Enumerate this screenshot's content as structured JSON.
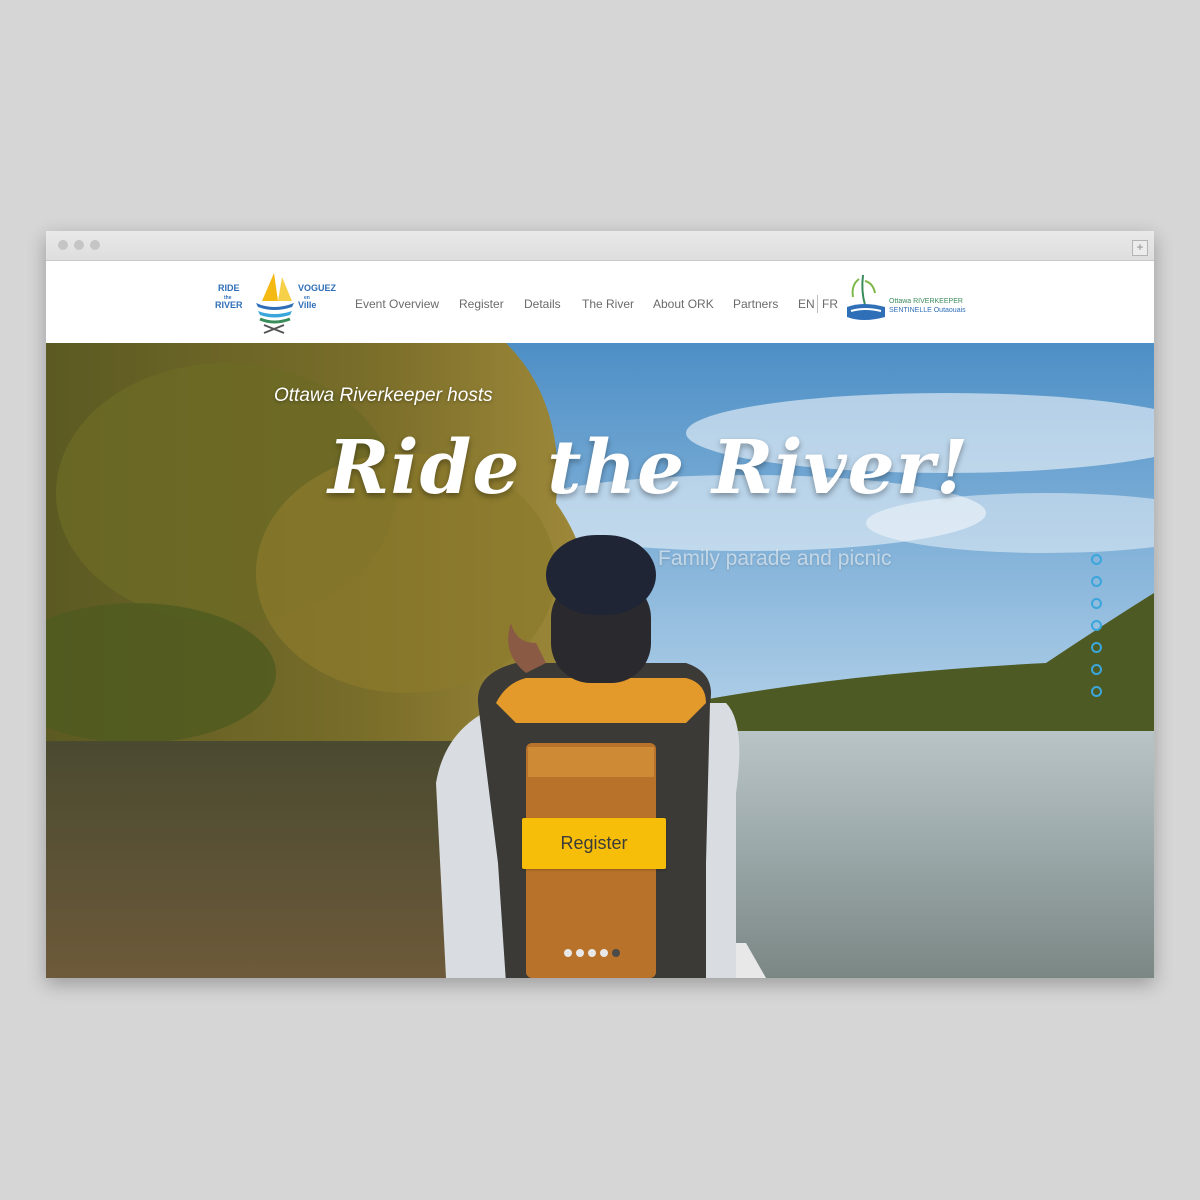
{
  "browser": {
    "window_dots": [
      "close",
      "minimize",
      "zoom"
    ],
    "new_tab_label": "+"
  },
  "header": {
    "logo": {
      "ride_line1": "RIDE",
      "ride_small": "the",
      "ride_line2": "RIVER",
      "voguez_line1": "VOGUEZ",
      "voguez_small": "en",
      "voguez_line2": "Ville"
    },
    "nav": [
      {
        "label": "Event Overview"
      },
      {
        "label": "Register"
      },
      {
        "label": "Details"
      },
      {
        "label": "The River"
      },
      {
        "label": "About ORK"
      },
      {
        "label": "Partners"
      }
    ],
    "lang_en": "EN",
    "lang_fr": "FR",
    "partner_logo": {
      "line1": "Ottawa RIVERKEEPER",
      "line2": "SENTINELLE Outaouais"
    }
  },
  "hero": {
    "hosts": "Ottawa Riverkeeper hosts",
    "title": "Ride the River!",
    "subtitle": "Family parade and picnic",
    "register_label": "Register",
    "section_nav_count": 7,
    "slide_count": 5,
    "active_slide": 5
  },
  "colors": {
    "accent_yellow": "#f6be08",
    "nav_blue": "#3aa6dc",
    "brand_blue": "#2f6fb8",
    "brand_green": "#3a8c5a"
  }
}
